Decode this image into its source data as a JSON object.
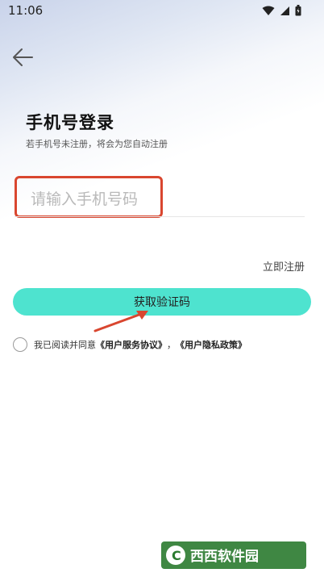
{
  "status_bar": {
    "time": "11:06",
    "icons": [
      "wifi-icon",
      "signal-icon",
      "battery-icon"
    ]
  },
  "header": {
    "back_icon": "arrow-left-icon"
  },
  "login": {
    "title": "手机号登录",
    "subtitle": "若手机号未注册，将会为您自动注册",
    "phone_placeholder": "请输入手机号码",
    "phone_value": "",
    "register_label": "立即注册",
    "get_code_label": "获取验证码"
  },
  "agreement": {
    "prefix": "我已阅读并同意",
    "service_link": "《用户服务协议》",
    "separator": "，",
    "privacy_link": "《用户隐私政策》"
  },
  "colors": {
    "accent": "#4ee3cf",
    "highlight_border": "#d9462f",
    "arrow": "#d9462f"
  }
}
